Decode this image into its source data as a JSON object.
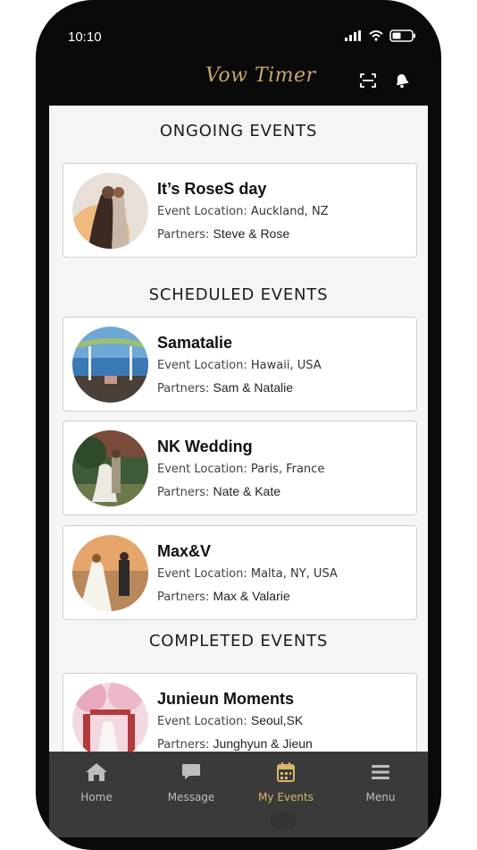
{
  "status": {
    "time": "10:10"
  },
  "header": {
    "logo": "Vow Timer",
    "scan_icon": "scan-icon",
    "bell_icon": "bell-icon"
  },
  "colors": {
    "accent": "#d8b66a",
    "tab_bg": "#3a3a3a",
    "screen_bg": "#f5f5f5"
  },
  "sections": {
    "ongoing": "ONGOING EVENTS",
    "scheduled": "SCHEDULED EVENTS",
    "completed": "COMPLETED EVENTS"
  },
  "labels": {
    "location": "Event Location: ",
    "partners": "Partners: "
  },
  "events": [
    {
      "title": "It’s RoseS day",
      "location": "Auckland, NZ",
      "partners": "Steve & Rose"
    },
    {
      "title": "Samatalie",
      "location": "Hawaii, USA",
      "partners": "Sam & Natalie"
    },
    {
      "title": "NK Wedding",
      "location": "Paris, France",
      "partners": "Nate & Kate"
    },
    {
      "title": "Max&V",
      "location": "Malta, NY, USA",
      "partners": "Max & Valarie"
    },
    {
      "title": "Junieun Moments",
      "location": "Seoul,SK",
      "partners": "Junghyun & Jieun"
    }
  ],
  "tabs": [
    {
      "label": "Home",
      "icon": "home-icon"
    },
    {
      "label": "Message",
      "icon": "message-icon"
    },
    {
      "label": "My Events",
      "icon": "calendar-icon"
    },
    {
      "label": "Menu",
      "icon": "menu-icon"
    }
  ]
}
